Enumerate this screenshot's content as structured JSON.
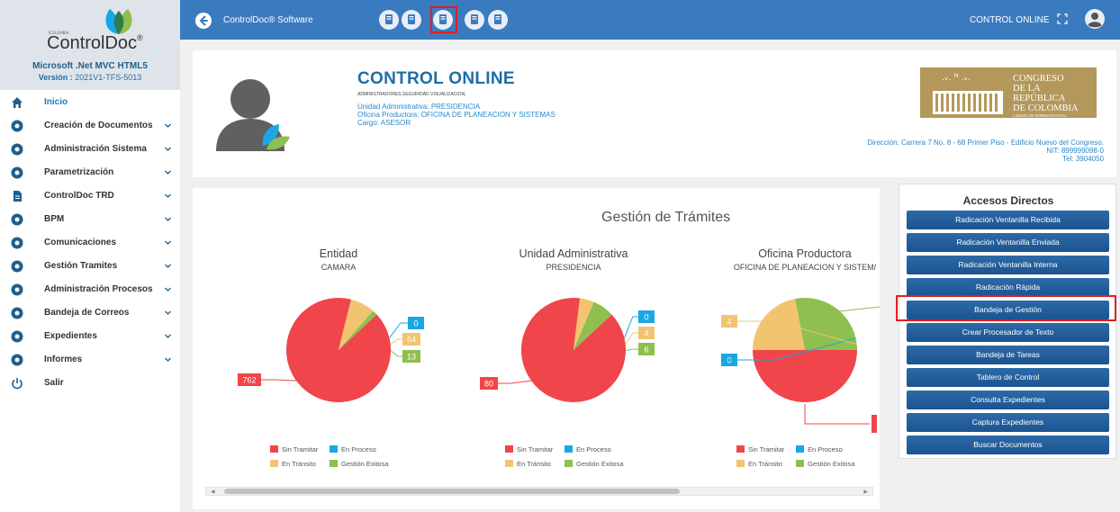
{
  "app": {
    "title": "ControlDoc® Software",
    "user_name": "CONTROL ONLINE"
  },
  "logo": {
    "tagline": "ICOLOMBIA",
    "brand": "ControlDoc",
    "subtitle": "Microsoft .Net MVC HTML5",
    "version_label": "Versión :",
    "version_value": "2021V1-TFS-5013"
  },
  "sidebar": {
    "items": [
      {
        "label": "Inicio",
        "icon": "home-icon",
        "active": true
      },
      {
        "label": "Creación de Documentos",
        "icon": "plus-circle-icon"
      },
      {
        "label": "Administración Sistema",
        "icon": "user-circle-icon"
      },
      {
        "label": "Parametrización",
        "icon": "gear-icon"
      },
      {
        "label": "ControlDoc TRD",
        "icon": "file-icon"
      },
      {
        "label": "BPM",
        "icon": "globe-icon"
      },
      {
        "label": "Comunicaciones",
        "icon": "history-icon"
      },
      {
        "label": "Gestión Tramites",
        "icon": "steering-icon"
      },
      {
        "label": "Administración Procesos",
        "icon": "pie-icon"
      },
      {
        "label": "Bandeja de Correos",
        "icon": "compass-icon"
      },
      {
        "label": "Expedientes",
        "icon": "compass-icon"
      },
      {
        "label": "Informes",
        "icon": "dot-circle-icon"
      },
      {
        "label": "Salir",
        "icon": "power-icon"
      }
    ]
  },
  "topbar_icons": [
    "document-search-icon",
    "search-icon",
    "inbox-icon",
    "print-icon",
    "book-icon"
  ],
  "profile": {
    "name": "CONTROL ONLINE",
    "roles": "ADMINISTRADORES,SEGURIDAD VISUALIZACION,",
    "unit": "Unidad Administrativa: PRESIDENCIA",
    "office": "Oficina Productora: OFICINA DE PLANEACION Y SISTEMAS",
    "position": "Cargo: ASESOR"
  },
  "entity": {
    "logo_line1": "CONGRESO",
    "logo_line2": "DE LA REPÚBLICA",
    "logo_line3": "DE COLOMBIA",
    "logo_line4": "CÁMARA DE REPRESENTANTES",
    "address": "Dirección:   Carrera 7 No. 8 - 68 Primer Piso - Edificio Nuevo del Congreso.",
    "nit": "NIT:  899999098-0",
    "tel": "Tel:  3904050"
  },
  "charts": {
    "main_title": "Gestión de Trámites",
    "legend": [
      "Sin Tramitar",
      "En Proceso",
      "En Tránsito",
      "Gestión Exitosa"
    ],
    "colors": {
      "sin_tramitar": "#f0454a",
      "en_proceso": "#1aa7e6",
      "en_transito": "#f2c46f",
      "gestion_exitosa": "#8ebf4f"
    }
  },
  "chart_data": [
    {
      "type": "pie",
      "title": "Entidad",
      "subtitle": "CAMARA",
      "categories": [
        "Sin Tramitar",
        "En Proceso",
        "En Tránsito",
        "Gestión Exitosa"
      ],
      "values": [
        762,
        0,
        64,
        13
      ]
    },
    {
      "type": "pie",
      "title": "Unidad Administrativa",
      "subtitle": "PRESIDENCIA",
      "categories": [
        "Sin Tramitar",
        "En Proceso",
        "En Tránsito",
        "Gestión Exitosa"
      ],
      "values": [
        80,
        0,
        4,
        6
      ]
    },
    {
      "type": "pie",
      "title": "Oficina Productora",
      "subtitle": "OFICINA DE PLANEACION Y SISTEM/",
      "categories": [
        "Sin Tramitar",
        "En Proceso",
        "En Tránsito",
        "Gestión Exitosa"
      ],
      "values": [
        null,
        0,
        4,
        null
      ]
    }
  ],
  "accesos": {
    "title": "Accesos Directos",
    "buttons": [
      "Radicación Ventanilla Recibida",
      "Radicación Ventanilla Enviada",
      "Radicación Ventanilla Interna",
      "Radicación Rápida",
      "Bandeja de Gestión",
      "Crear Procesador de Texto",
      "Bandeja de Tareas",
      "Tablero de Control",
      "Consulta Expedientes",
      "Captura Expedientes",
      "Buscar Documentos"
    ]
  }
}
